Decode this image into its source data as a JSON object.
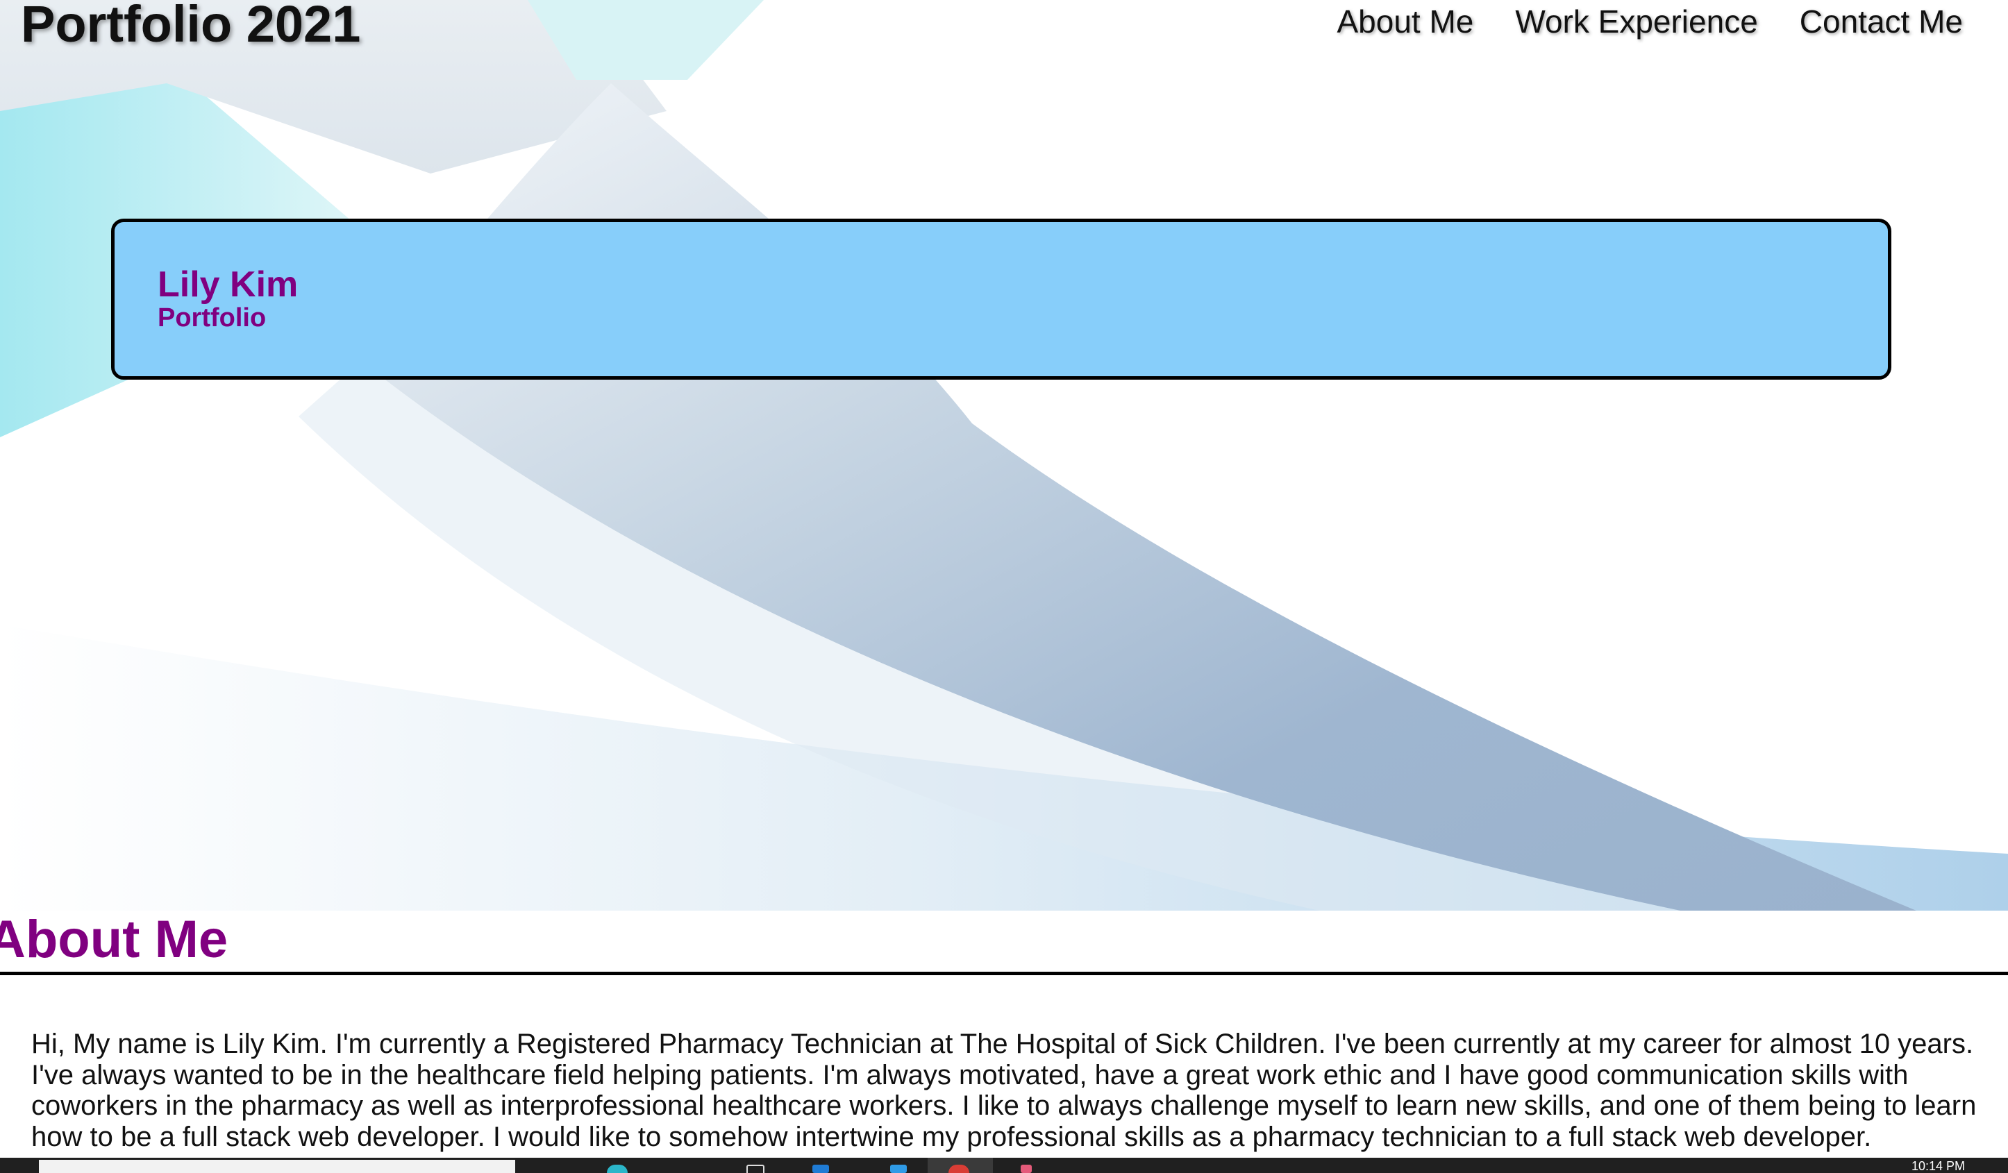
{
  "header": {
    "site_title": "Portfolio 2021",
    "nav": [
      {
        "label": "About Me"
      },
      {
        "label": "Work Experience"
      },
      {
        "label": "Contact Me"
      }
    ]
  },
  "hero": {
    "name": "Lily Kim",
    "subtitle": "Portfolio",
    "card_color": "#87cefa",
    "text_color": "#800080"
  },
  "about": {
    "heading": "About Me",
    "body": "Hi, My name is Lily Kim. I'm currently a Registered Pharmacy Technician at The Hospital of Sick Children. I've been currently at my career for almost 10 years. I've always wanted to be in the healthcare field helping patients. I'm always motivated, have a great work ethic and I have good communication skills with coworkers in the pharmacy as well as interprofessional healthcare workers. I like to always challenge myself to learn new skills, and one of them being to learn how to be a full stack web developer. I would like to somehow intertwine my professional skills as a pharmacy technician to a full stack web developer."
  },
  "taskbar": {
    "clock": "10:14 PM",
    "icons": [
      "edge-icon",
      "file-explorer-icon",
      "store-icon",
      "vscode-icon",
      "chrome-icon",
      "app-icon"
    ]
  }
}
